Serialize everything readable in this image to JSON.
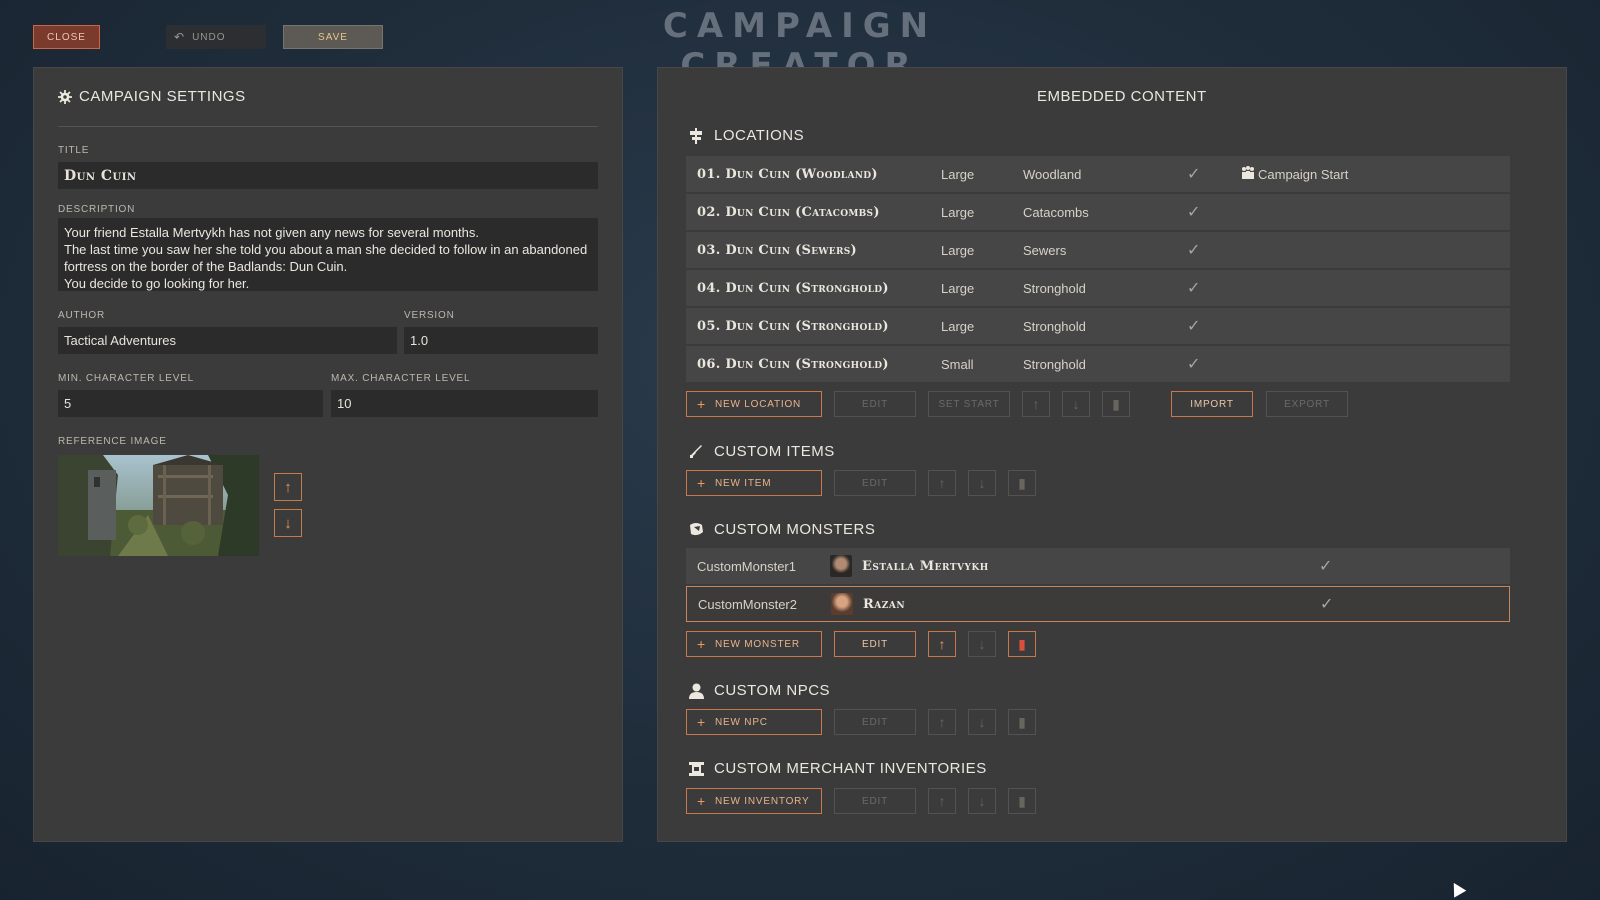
{
  "app_title": "CAMPAIGN CREATOR",
  "toolbar": {
    "close_label": "CLOSE",
    "undo_label": "UNDO",
    "save_label": "SAVE"
  },
  "settings": {
    "heading": "CAMPAIGN SETTINGS",
    "title_label": "TITLE",
    "title_value": "Dun Cuin",
    "description_label": "DESCRIPTION",
    "description_lines": [
      "Your friend Estalla Mertvykh has not given any news for several months.",
      "The last time you saw her she told you about a man she decided to follow in an abandoned fortress on the border of the Badlands: Dun Cuin.",
      "You decide to go looking for her."
    ],
    "author_label": "AUTHOR",
    "author_value": "Tactical Adventures",
    "version_label": "VERSION",
    "version_value": "1.0",
    "min_level_label": "MIN. CHARACTER LEVEL",
    "min_level_value": "5",
    "max_level_label": "MAX. CHARACTER LEVEL",
    "max_level_value": "10",
    "reference_image_label": "REFERENCE IMAGE"
  },
  "content": {
    "heading": "EMBEDDED CONTENT",
    "locations": {
      "title": "LOCATIONS",
      "rows": [
        {
          "name": "01. Dun Cuin (Woodland)",
          "size": "Large",
          "env": "Woodland",
          "start": "Campaign Start"
        },
        {
          "name": "02. Dun Cuin (Catacombs)",
          "size": "Large",
          "env": "Catacombs",
          "start": ""
        },
        {
          "name": "03. Dun Cuin (Sewers)",
          "size": "Large",
          "env": "Sewers",
          "start": ""
        },
        {
          "name": "04. Dun Cuin (Stronghold)",
          "size": "Large",
          "env": "Stronghold",
          "start": ""
        },
        {
          "name": "05. Dun Cuin (Stronghold)",
          "size": "Large",
          "env": "Stronghold",
          "start": ""
        },
        {
          "name": "06. Dun Cuin (Stronghold)",
          "size": "Small",
          "env": "Stronghold",
          "start": ""
        }
      ],
      "new_label": "NEW LOCATION",
      "edit_label": "EDIT",
      "set_start_label": "SET START",
      "import_label": "IMPORT",
      "export_label": "EXPORT"
    },
    "items": {
      "title": "CUSTOM ITEMS",
      "new_label": "NEW ITEM",
      "edit_label": "EDIT"
    },
    "monsters": {
      "title": "CUSTOM MONSTERS",
      "rows": [
        {
          "id": "CustomMonster1",
          "name": "Estalla Mertvykh"
        },
        {
          "id": "CustomMonster2",
          "name": "Razan"
        }
      ],
      "new_label": "NEW MONSTER",
      "edit_label": "EDIT"
    },
    "npcs": {
      "title": "CUSTOM NPCS",
      "new_label": "NEW NPC",
      "edit_label": "EDIT"
    },
    "inventories": {
      "title": "CUSTOM MERCHANT INVENTORIES",
      "new_label": "NEW INVENTORY",
      "edit_label": "EDIT"
    }
  },
  "icons": {
    "check": "check-icon",
    "arrow_up": "arrow-up-icon",
    "arrow_down": "arrow-down-icon",
    "trash": "trash-icon",
    "plus": "plus-icon",
    "gear": "gear-icon",
    "party": "party-icon"
  },
  "colors": {
    "accent": "#c8784a",
    "danger": "#d9503d",
    "panel": "#3b3b3b",
    "background": "#1f2d3b"
  }
}
